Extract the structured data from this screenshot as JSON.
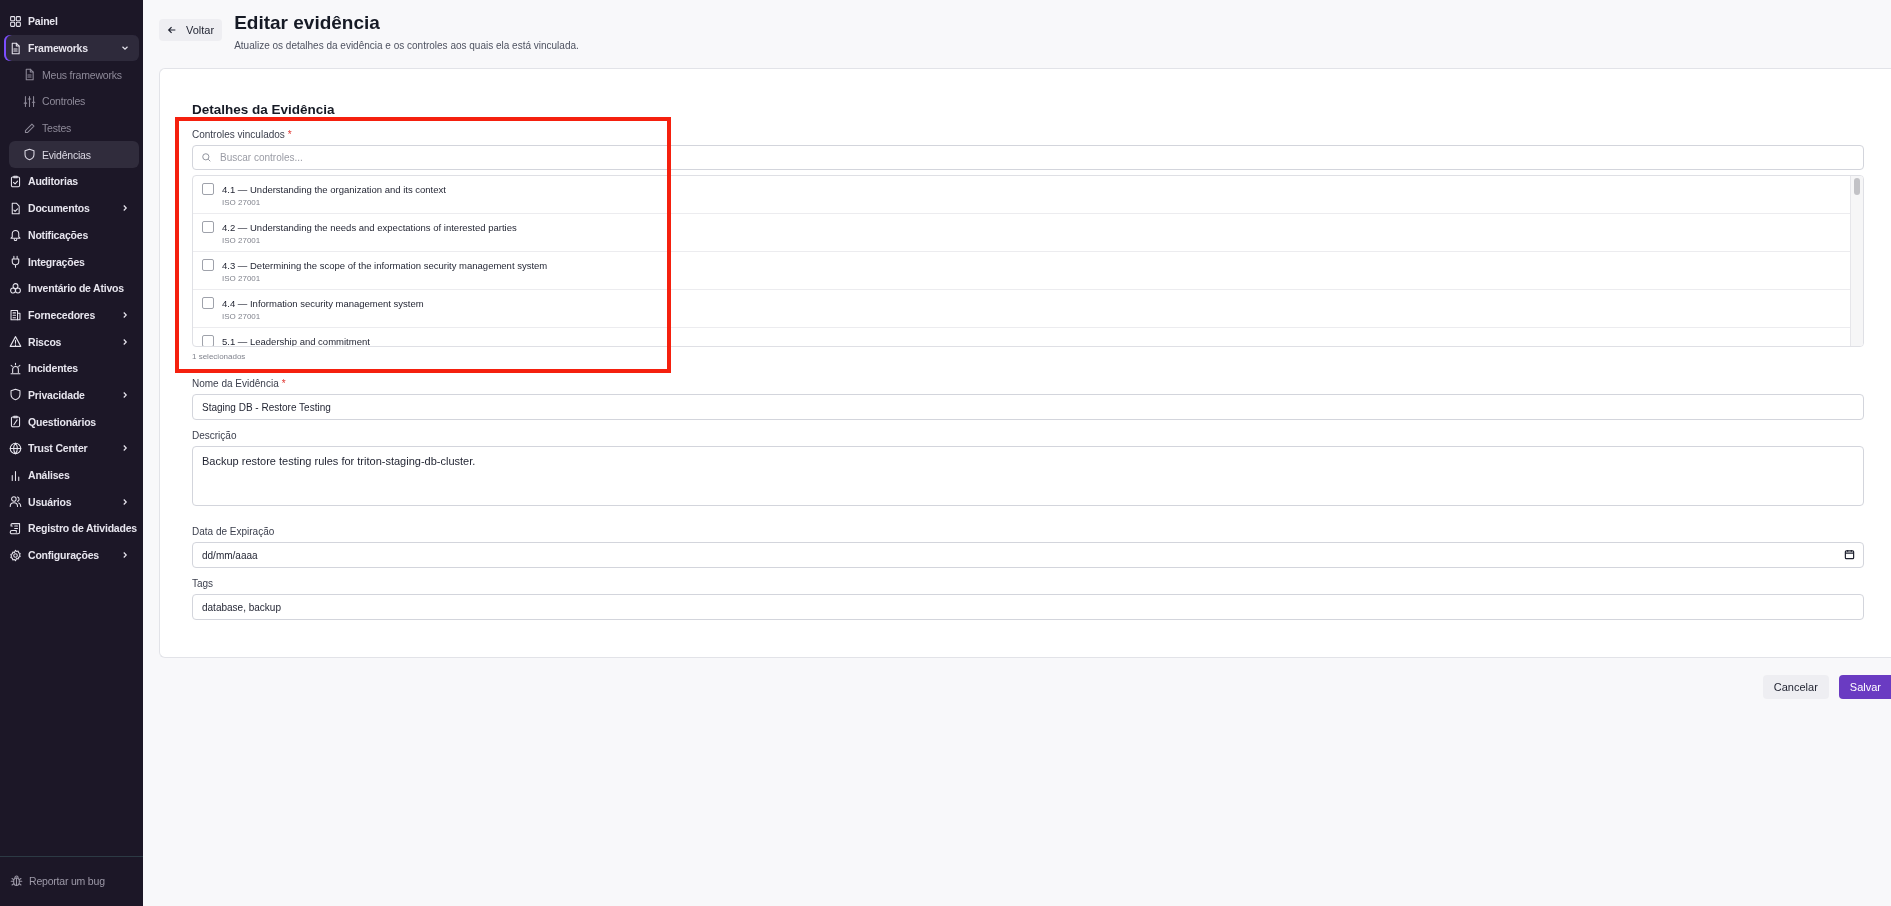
{
  "sidebar": {
    "items": [
      {
        "label": "Painel",
        "kind": "link",
        "selected": false
      },
      {
        "label": "Frameworks",
        "kind": "group",
        "expanded": true,
        "selected": true,
        "children": [
          {
            "label": "Meus frameworks",
            "selected": false
          },
          {
            "label": "Controles",
            "selected": false
          },
          {
            "label": "Testes",
            "selected": false
          },
          {
            "label": "Evidências",
            "selected": true
          }
        ]
      },
      {
        "label": "Auditorias",
        "kind": "link",
        "selected": false
      },
      {
        "label": "Documentos",
        "kind": "group",
        "expanded": false,
        "selected": false
      },
      {
        "label": "Notificações",
        "kind": "link",
        "selected": false
      },
      {
        "label": "Integrações",
        "kind": "link",
        "selected": false
      },
      {
        "label": "Inventário de Ativos",
        "kind": "link",
        "selected": false
      },
      {
        "label": "Fornecedores",
        "kind": "group",
        "expanded": false,
        "selected": false
      },
      {
        "label": "Riscos",
        "kind": "group",
        "expanded": false,
        "selected": false
      },
      {
        "label": "Incidentes",
        "kind": "link",
        "selected": false
      },
      {
        "label": "Privacidade",
        "kind": "group",
        "expanded": false,
        "selected": false
      },
      {
        "label": "Questionários",
        "kind": "link",
        "selected": false
      },
      {
        "label": "Trust Center",
        "kind": "group",
        "expanded": false,
        "selected": false
      },
      {
        "label": "Análises",
        "kind": "link",
        "selected": false
      },
      {
        "label": "Usuários",
        "kind": "group",
        "expanded": false,
        "selected": false
      },
      {
        "label": "Registro de Atividades",
        "kind": "link",
        "selected": false
      },
      {
        "label": "Configurações",
        "kind": "group",
        "expanded": false,
        "selected": false
      }
    ],
    "footer_link": "Reportar um bug"
  },
  "header": {
    "back_button": "Voltar",
    "title": "Editar evidência",
    "subtitle": "Atualize os detalhes da evidência e os controles aos quais ela está vinculada."
  },
  "form": {
    "section_title": "Detalhes da Evidência",
    "linked_controls": {
      "label": "Controles vinculados",
      "required_mark": "*",
      "search": {
        "placeholder": "Buscar controles..."
      },
      "options": [
        {
          "title": "4.1 — Understanding the organization and its context",
          "framework": "ISO 27001",
          "checked": false
        },
        {
          "title": "4.2 — Understanding the needs and expectations of interested parties",
          "framework": "ISO 27001",
          "checked": false
        },
        {
          "title": "4.3 — Determining the scope of the information security management system",
          "framework": "ISO 27001",
          "checked": false
        },
        {
          "title": "4.4 — Information security management system",
          "framework": "ISO 27001",
          "checked": false
        },
        {
          "title": "5.1 — Leadership and commitment",
          "checked": false
        }
      ],
      "selected_count": "1 selecionados"
    },
    "fields": [
      {
        "kind": "text",
        "label": "Nome da Evidência",
        "required_mark": "*",
        "value": "Staging DB - Restore Testing"
      },
      {
        "kind": "textarea",
        "label": "Descrição",
        "value": "Backup restore testing rules for triton-staging-db-cluster."
      },
      {
        "kind": "date",
        "label": "Data de Expiração",
        "placeholder": "dd/mm/aaaa"
      },
      {
        "kind": "text",
        "label": "Tags",
        "value": "database, backup"
      }
    ]
  },
  "actions": [
    "Cancelar",
    "Salvar"
  ]
}
